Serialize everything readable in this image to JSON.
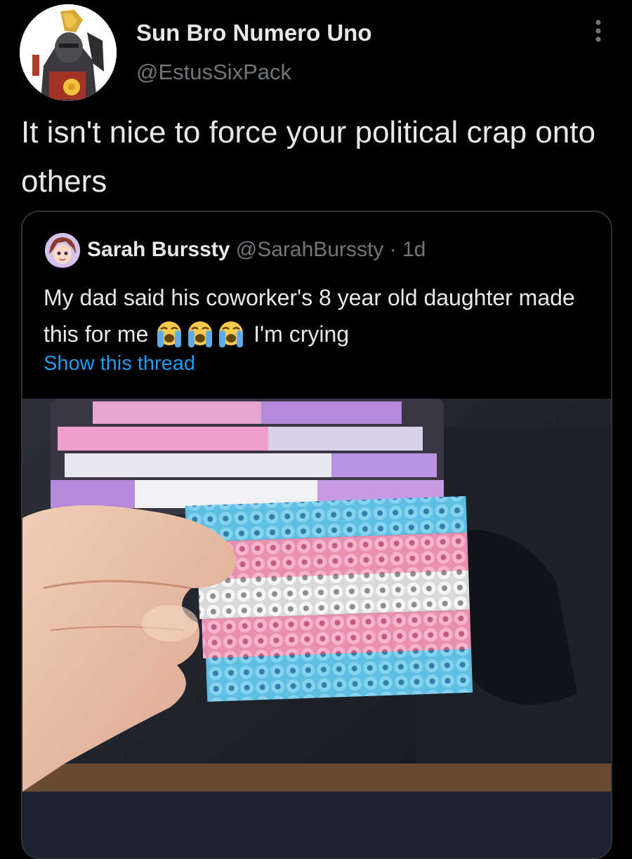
{
  "tweet": {
    "author": {
      "display_name": "Sun Bro Numero Uno",
      "handle": "@EstusSixPack",
      "avatar_icon": "sun-knight-avatar-icon"
    },
    "text": "It isn't nice to force your political crap onto others",
    "more_icon": "more-options-icon"
  },
  "quote": {
    "author": {
      "display_name": "Sarah Burssty",
      "handle": "@SarahBurssty",
      "separator": "·",
      "time": "1d",
      "avatar_icon": "anime-avatar-icon"
    },
    "text_before_emoji": "My dad said his coworker's 8 year old daughter made this for me",
    "emoji": [
      "loudly-crying-face-emoji",
      "loudly-crying-face-emoji",
      "loudly-crying-face-emoji"
    ],
    "text_after_emoji": "I'm crying",
    "show_thread": "Show this thread",
    "media": {
      "description_icon": "photo-perler-bead-trans-flag",
      "stripe_colors": [
        "#6cc7ea",
        "#f5a9c4",
        "#f2f2f2",
        "#f5a9c4",
        "#6cc7ea"
      ]
    }
  },
  "colors": {
    "background": "#000000",
    "text_primary": "#e7e9ea",
    "text_secondary": "#71767b",
    "link": "#1d9bf0",
    "border": "#2f3336"
  }
}
